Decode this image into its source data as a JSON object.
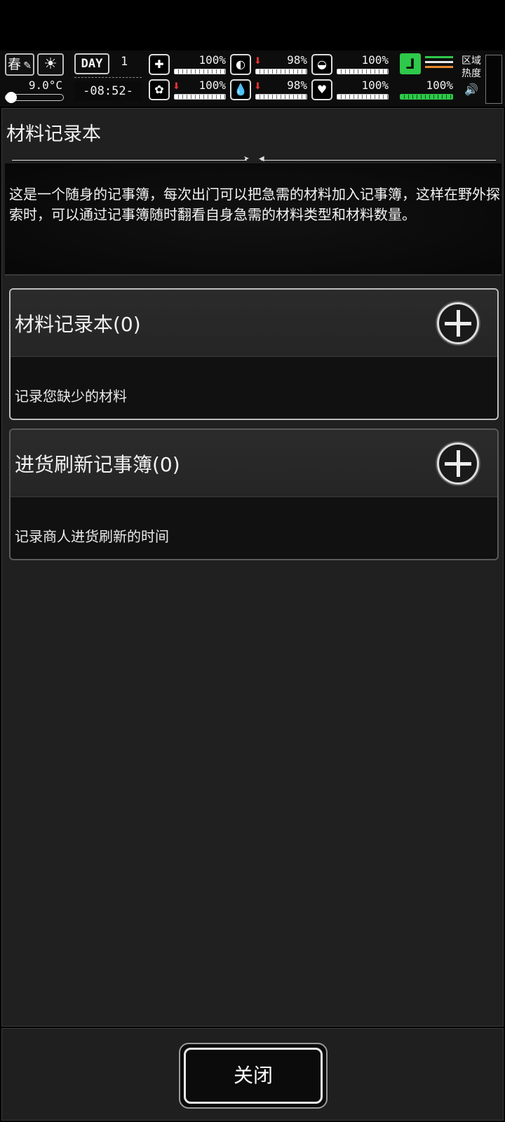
{
  "hud": {
    "season": "春",
    "temperature": "9.0°C",
    "day_label": "DAY",
    "day_number": "1",
    "clock": "-08:52-",
    "stats": [
      {
        "name": "health",
        "icon": "medkit-icon",
        "glyph": "✚",
        "value": "100%",
        "arrow": ""
      },
      {
        "name": "hunger",
        "icon": "stomach-icon",
        "glyph": "◐",
        "value": "98%",
        "arrow": "⬇"
      },
      {
        "name": "sleep",
        "icon": "pill-icon",
        "glyph": "◒",
        "value": "100%",
        "arrow": ""
      },
      {
        "name": "mind",
        "icon": "brain-icon",
        "glyph": "✿",
        "value": "100%",
        "arrow": "⬇"
      },
      {
        "name": "thirst",
        "icon": "water-drop-icon",
        "glyph": "💧",
        "value": "98%",
        "arrow": "⬇"
      },
      {
        "name": "mood",
        "icon": "heart-icon",
        "glyph": "♥",
        "value": "100%",
        "arrow": ""
      }
    ],
    "stamina_value": "100%",
    "zone_label": "区域热度",
    "colors": {
      "stamina_green": "#2ec94a",
      "arrow_red": "#e03030",
      "line_orange": "#e8892c"
    }
  },
  "panel": {
    "title": "材料记录本",
    "description": "这是一个随身的记事簿，每次出门可以把急需的材料加入记事簿，这样在野外探索时，可以通过记事簿随时翻看自身急需的材料类型和材料数量。"
  },
  "cards": [
    {
      "title": "材料记录本(0)",
      "subtitle": "记录您缺少的材料"
    },
    {
      "title": "进货刷新记事簿(0)",
      "subtitle": "记录商人进货刷新的时间"
    }
  ],
  "footer": {
    "close_label": "关闭"
  }
}
